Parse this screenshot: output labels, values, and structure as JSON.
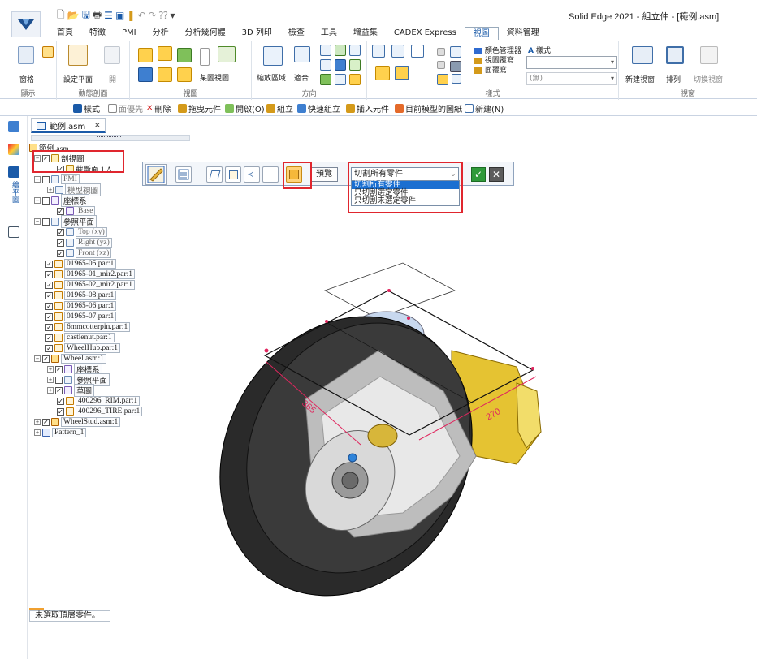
{
  "window": {
    "title": "Solid Edge 2021 - 組立件 - [範例.asm]"
  },
  "tabs": [
    "首頁",
    "特徵",
    "PMI",
    "分析",
    "分析幾何體",
    "3D 列印",
    "檢查",
    "工具",
    "增益集",
    "CADEX Express",
    "視圖",
    "資料管理"
  ],
  "active_tab": "視圖",
  "ribbon": {
    "show_group": {
      "label": "顯示",
      "button": "窗格"
    },
    "section_group": {
      "label": "動態剖面",
      "button1": "設定平面",
      "button2": "開"
    },
    "views_group": {
      "label": "視圖",
      "button": "某圖視圖"
    },
    "orient_group": {
      "label": "方向",
      "zoom_area": "縮放區域",
      "fit": "適合"
    },
    "style_group": {
      "label": "樣式",
      "color_manager": "顏色管理器",
      "view_override": "視圖覆寫",
      "face_override": "面覆寫",
      "style": "樣式",
      "combo_value": "",
      "combo2_value": "(無)"
    },
    "window_group": {
      "label": "視窗",
      "new_window": "新建視窗",
      "arrange": "排列",
      "switch_window": "切換視窗"
    }
  },
  "commandbar": {
    "style": "樣式",
    "face_priority": "面優先",
    "delete": "刪除",
    "drag_component": "拖曳元件",
    "open": "開啟(O)",
    "assemble": "組立",
    "quick_assemble": "快速組立",
    "insert_component": "插入元件",
    "target_drawing": "目前模型的圖紙",
    "new": "新建(N)"
  },
  "leftbar": {
    "vertical_label": "繪平圖"
  },
  "document_tab": {
    "label": "範例.asm",
    "close": "×"
  },
  "tree": [
    {
      "label": "範例.asm",
      "icon": "asm"
    },
    {
      "label": "剖視圖",
      "icon": "sec",
      "checked": true
    },
    {
      "label": "截斷面 1 A",
      "icon": "sec",
      "checked": true
    },
    {
      "label": "PMI",
      "icon": "ref",
      "checked": false
    },
    {
      "label": "模型視圖",
      "icon": "ref"
    },
    {
      "label": "座標系",
      "icon": "cs",
      "checked": false
    },
    {
      "label": "Base",
      "icon": "cs",
      "checked": true
    },
    {
      "label": "參照平面",
      "icon": "ref",
      "checked": false
    },
    {
      "label": "Top (xy)",
      "icon": "ref",
      "checked": true
    },
    {
      "label": "Right (yz)",
      "icon": "ref",
      "checked": true
    },
    {
      "label": "Front (xz)",
      "icon": "ref",
      "checked": true
    },
    {
      "label": "01965-05.par:1",
      "icon": "part",
      "checked": true
    },
    {
      "label": "01965-01_mir2.par:1",
      "icon": "part",
      "checked": true
    },
    {
      "label": "01965-02_mir2.par:1",
      "icon": "part",
      "checked": true
    },
    {
      "label": "01965-08.par:1",
      "icon": "part",
      "checked": true
    },
    {
      "label": "01965-06.par:1",
      "icon": "part",
      "checked": true
    },
    {
      "label": "01965-07.par:1",
      "icon": "part",
      "checked": true
    },
    {
      "label": "6mmcotterpin.par:1",
      "icon": "part",
      "checked": true
    },
    {
      "label": "castlenut.par:1",
      "icon": "part",
      "checked": true
    },
    {
      "label": "WheelHub.par:1",
      "icon": "part",
      "checked": true
    },
    {
      "label": "Wheel.asm:1",
      "icon": "asm",
      "checked": true
    },
    {
      "label": "座標系",
      "icon": "cs",
      "checked": true
    },
    {
      "label": "參照平面",
      "icon": "ref",
      "checked": false
    },
    {
      "label": "草圖",
      "icon": "cs",
      "checked": true
    },
    {
      "label": "400296_RIM.par:1",
      "icon": "part",
      "checked": true
    },
    {
      "label": "400296_TIRE.par:1",
      "icon": "part",
      "checked": true
    },
    {
      "label": "WheelStud.asm:1",
      "icon": "asm",
      "checked": true
    },
    {
      "label": "Pattern_1",
      "icon": "pat"
    }
  ],
  "floatbar": {
    "preview": "預覽",
    "select_value": "切割所有零件",
    "options": [
      "切割所有零件",
      "只切割選定零件",
      "只切割未選定零件"
    ],
    "ok": "✓",
    "cancel": "✕"
  },
  "status": "未選取頂層零件。",
  "viewport": {
    "dim_left": "365",
    "dim_right": "270"
  },
  "colors": {
    "accent": "#1a5aa8",
    "highlight": "#e0262e",
    "selection": "#1b6fd1"
  }
}
